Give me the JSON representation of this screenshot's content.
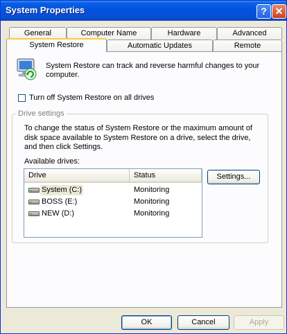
{
  "window": {
    "title": "System Properties",
    "help_glyph": "?",
    "close_glyph": "✕"
  },
  "tabs_back": [
    "General",
    "Computer Name",
    "Hardware",
    "Advanced"
  ],
  "tabs_front": [
    "System Restore",
    "Automatic Updates",
    "Remote"
  ],
  "active_tab": "System Restore",
  "intro": "System Restore can track and reverse harmful changes to your computer.",
  "turn_off_label": "Turn off System Restore on all drives",
  "drive_settings": {
    "label": "Drive settings",
    "description": "To change the status of System Restore or the maximum amount of disk space available to System Restore on a drive, select the drive, and then click Settings.",
    "available_label": "Available drives:",
    "columns": [
      "Drive",
      "Status"
    ],
    "drives": [
      {
        "name": "System (C:)",
        "status": "Monitoring"
      },
      {
        "name": "BOSS (E:)",
        "status": "Monitoring"
      },
      {
        "name": "NEW (D:)",
        "status": "Monitoring"
      }
    ],
    "settings_button": "Settings..."
  },
  "footer": {
    "ok": "OK",
    "cancel": "Cancel",
    "apply": "Apply"
  }
}
